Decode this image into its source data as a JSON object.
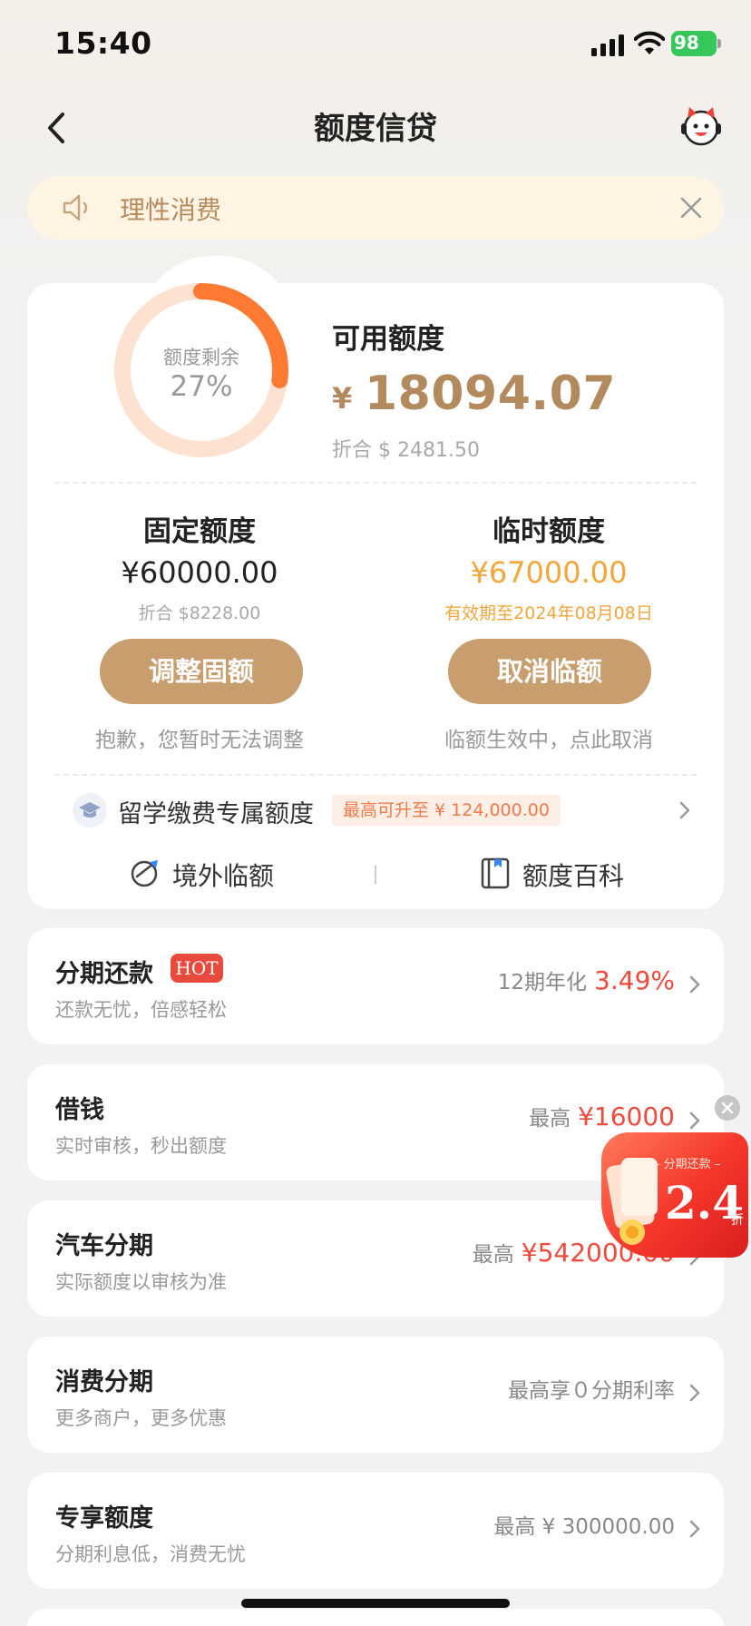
{
  "status_bar": {
    "time": "15:40",
    "battery": "98"
  },
  "nav": {
    "title": "额度信贷"
  },
  "notice": {
    "text": "理性消费"
  },
  "limit": {
    "gauge_label": "额度剩余",
    "gauge_percent": "27%",
    "gauge_fraction": 0.27,
    "available_title": "可用额度",
    "currency_symbol": "¥",
    "available_amount": "18094.07",
    "available_converted": "折合 $ 2481.50"
  },
  "fixed": {
    "title": "固定额度",
    "amount": "¥60000.00",
    "converted": "折合 $8228.00",
    "button": "调整固额",
    "note": "抱歉，您暂时无法调整"
  },
  "temporary": {
    "title": "临时额度",
    "amount": "¥67000.00",
    "valid_until": "有效期至2024年08月08日",
    "button": "取消临额",
    "note": "临额生效中，点此取消"
  },
  "study": {
    "title": "留学缴费专属额度",
    "badge": "最高可升至 ¥ 124,000.00"
  },
  "links": {
    "overseas": "境外临额",
    "encyclopedia": "额度百科"
  },
  "services": [
    {
      "title": "分期还款",
      "badge": "HOT",
      "subtitle": "还款无忧，倍感轻松",
      "prefix": "12期年化",
      "value": "3.49%"
    },
    {
      "title": "借钱",
      "subtitle": "实时审核，秒出额度",
      "prefix": "最高",
      "value": "¥16000"
    },
    {
      "title": "汽车分期",
      "subtitle": "实际额度以审核为准",
      "prefix": "最高",
      "value": "¥542000.00"
    },
    {
      "title": "消费分期",
      "subtitle": "更多商户，更多优惠",
      "prefix": "最高享０分期利率",
      "value": ""
    },
    {
      "title": "专享额度",
      "subtitle": "分期利息低，消费无忧",
      "prefix": "最高 ¥ 300000.00",
      "value": ""
    }
  ],
  "promo": {
    "label": "– 分期还款 –",
    "value": "2.4",
    "unit": "折"
  },
  "colors": {
    "brand_gold": "#c99e6e",
    "amount_gold": "#b38a5e",
    "temp_orange": "#f2a63b",
    "accent_red": "#f04a3c",
    "gauge_orange": "#ff7a33"
  }
}
